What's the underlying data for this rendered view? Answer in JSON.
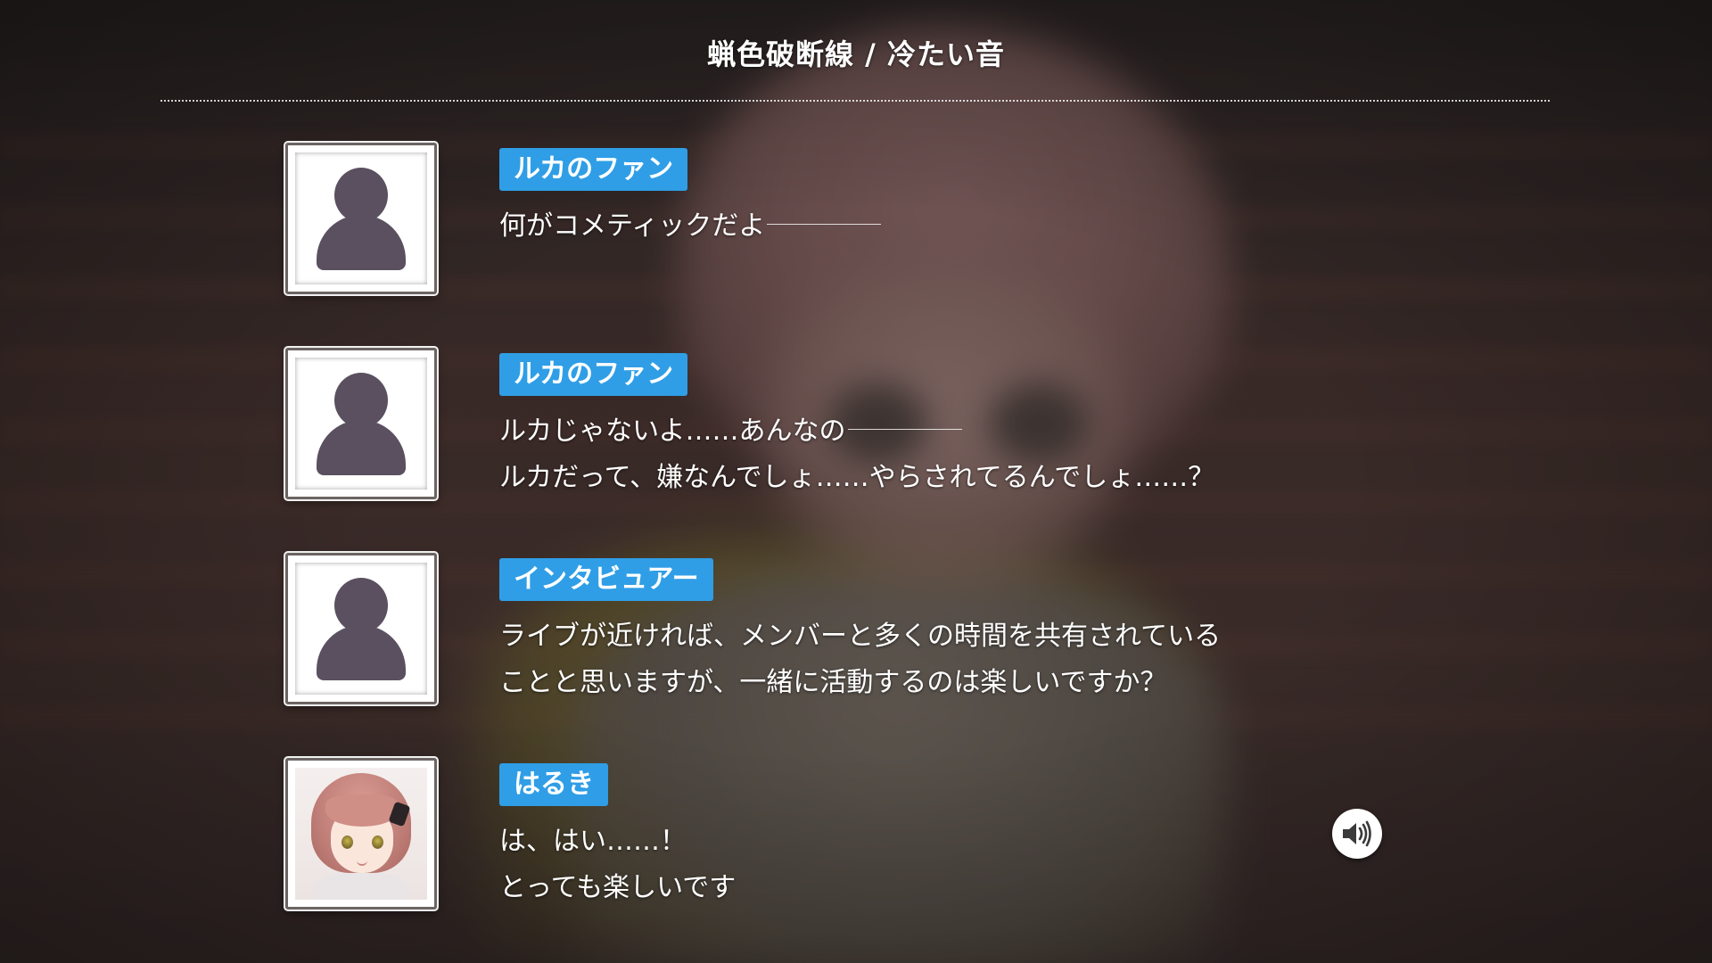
{
  "header": {
    "title": "蝋色破断線 / 冷たい音"
  },
  "log": [
    {
      "speaker": "ルカのファン",
      "avatar": "silhouette",
      "lines": [
        "何がコメティックだよ"
      ],
      "trailing_dash": true
    },
    {
      "speaker": "ルカのファン",
      "avatar": "silhouette",
      "lines": [
        "ルカじゃないよ……あんなの",
        "ルカだって、嫌なんでしょ……やらされてるんでしょ……？"
      ],
      "trailing_dash": true
    },
    {
      "speaker": "インタビュアー",
      "avatar": "silhouette",
      "lines": [
        "ライブが近ければ、メンバーと多くの時間を共有されている",
        "ことと思いますが、一緒に活動するのは楽しいですか？"
      ],
      "trailing_dash": false
    },
    {
      "speaker": "はるき",
      "avatar": "character-portrait",
      "lines": [
        "は、はい……！",
        "とっても楽しいです"
      ],
      "trailing_dash": false
    }
  ],
  "voice_button": {
    "icon": "speaker-icon"
  },
  "colors": {
    "speaker_tag": "#2f9ee6",
    "text": "#ffffff",
    "silhouette": "#5a5060"
  }
}
